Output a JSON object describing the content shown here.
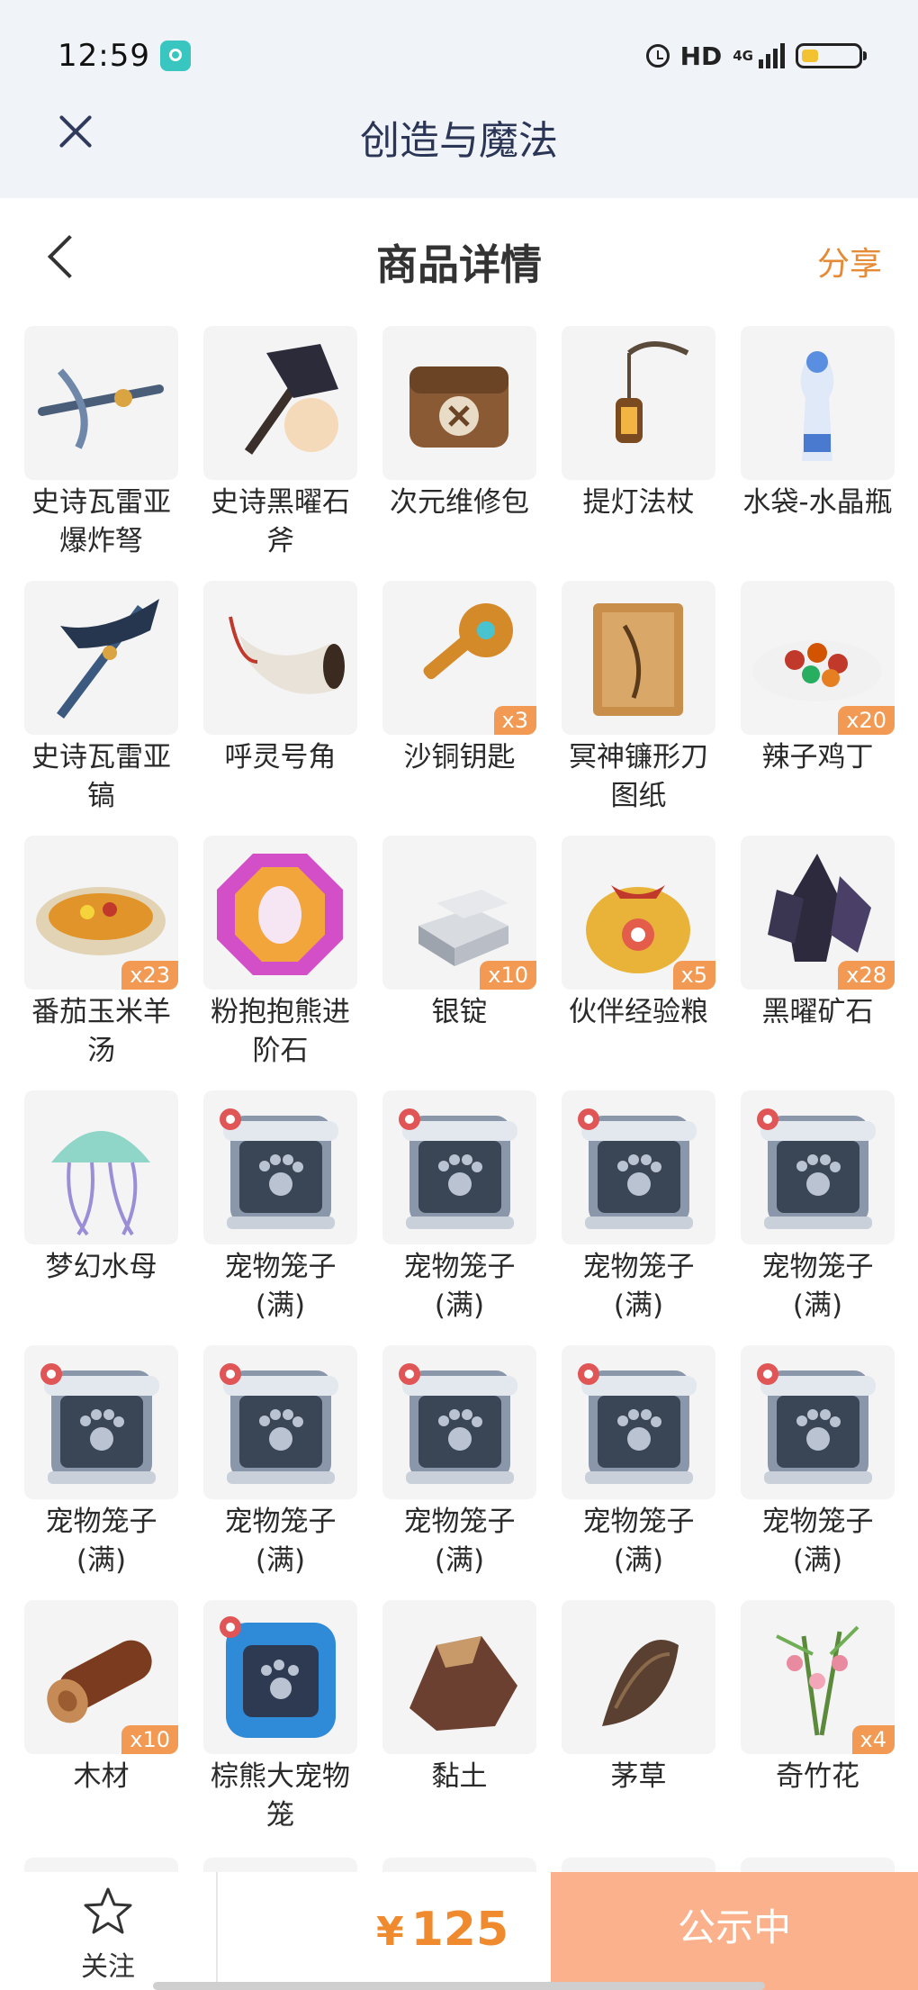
{
  "status_bar": {
    "time": "12:59",
    "hd": "HD",
    "network": "4G",
    "icons": [
      "app-notification-icon",
      "alarm-icon",
      "signal-icon",
      "battery-icon"
    ]
  },
  "app_header": {
    "title": "创造与魔法",
    "close_icon": "close-icon"
  },
  "page_header": {
    "title": "商品详情",
    "share": "分享",
    "back_icon": "chevron-left-icon"
  },
  "items": [
    {
      "name": "史诗瓦雷亚爆炸弩",
      "qty": ""
    },
    {
      "name": "史诗黑曜石斧",
      "qty": ""
    },
    {
      "name": "次元维修包",
      "qty": ""
    },
    {
      "name": "提灯法杖",
      "qty": ""
    },
    {
      "name": "水袋-水晶瓶",
      "qty": ""
    },
    {
      "name": "史诗瓦雷亚镐",
      "qty": ""
    },
    {
      "name": "呼灵号角",
      "qty": ""
    },
    {
      "name": "沙铜钥匙",
      "qty": "x3"
    },
    {
      "name": "冥神镰形刀图纸",
      "qty": ""
    },
    {
      "name": "辣子鸡丁",
      "qty": "x20"
    },
    {
      "name": "番茄玉米羊汤",
      "qty": "x23"
    },
    {
      "name": "粉抱抱熊进阶石",
      "qty": ""
    },
    {
      "name": "银锭",
      "qty": "x10"
    },
    {
      "name": "伙伴经验粮",
      "qty": "x5"
    },
    {
      "name": "黑曜矿石",
      "qty": "x28"
    },
    {
      "name": "梦幻水母",
      "qty": ""
    },
    {
      "name": "宠物笼子(满)",
      "qty": ""
    },
    {
      "name": "宠物笼子(满)",
      "qty": ""
    },
    {
      "name": "宠物笼子(满)",
      "qty": ""
    },
    {
      "name": "宠物笼子(满)",
      "qty": ""
    },
    {
      "name": "宠物笼子(满)",
      "qty": ""
    },
    {
      "name": "宠物笼子(满)",
      "qty": ""
    },
    {
      "name": "宠物笼子(满)",
      "qty": ""
    },
    {
      "name": "宠物笼子(满)",
      "qty": ""
    },
    {
      "name": "宠物笼子(满)",
      "qty": ""
    },
    {
      "name": "木材",
      "qty": "x10"
    },
    {
      "name": "棕熊大宠物笼",
      "qty": ""
    },
    {
      "name": "黏土",
      "qty": ""
    },
    {
      "name": "茅草",
      "qty": ""
    },
    {
      "name": "奇竹花",
      "qty": "x4"
    }
  ],
  "bottom_bar": {
    "follow_label": "关注",
    "price_symbol": "¥",
    "price": "125",
    "status_button": "公示中",
    "colors": {
      "price": "#f08a2e",
      "status_button": "#fbb18b",
      "accent": "#e58a35"
    }
  }
}
